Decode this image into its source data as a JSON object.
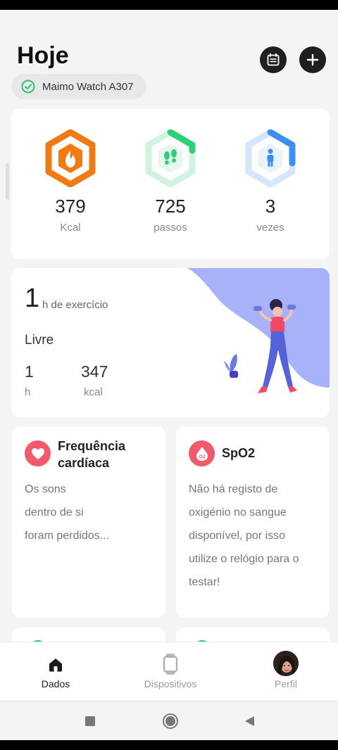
{
  "header": {
    "title": "Hoje",
    "calendar_icon": "calendar-icon",
    "add_icon": "plus-icon",
    "device": {
      "name": "Maimo Watch A307",
      "status_icon": "check-circle-icon",
      "status_color": "#2fbf71"
    }
  },
  "stats": [
    {
      "value": "379",
      "unit": "Kcal",
      "icon": "flame-icon",
      "color": "#f07a14",
      "progress": 1.0
    },
    {
      "value": "725",
      "unit": "passos",
      "icon": "footprints-icon",
      "color": "#2fcf7a",
      "progress": 0.14
    },
    {
      "value": "3",
      "unit": "vezes",
      "icon": "standing-person-icon",
      "color": "#3b8ff0",
      "progress": 0.33
    }
  ],
  "exercise": {
    "value": "1",
    "unit": "h de exercício",
    "mode": "Livre",
    "duration_value": "1",
    "duration_unit": "h",
    "calories_value": "347",
    "calories_unit": "kcal",
    "accent_color": "#a8b2f8"
  },
  "heart_rate": {
    "title": "Frequência cardíaca",
    "icon": "heart-icon",
    "lines": [
      "Os sons",
      "dentro de si",
      "foram perdidos..."
    ]
  },
  "spo2": {
    "title": "SpO2",
    "icon": "o2-drop-icon",
    "icon_text": "O2",
    "lines": [
      "Não há registo de",
      "oxigénio no sangue",
      "disponível, por isso",
      "utilize o relógio para o",
      "testar!"
    ]
  },
  "bottom_nav": [
    {
      "label": "Dados",
      "icon": "home-icon",
      "active": true
    },
    {
      "label": "Dispositivos",
      "icon": "watch-icon",
      "active": false
    },
    {
      "label": "Perfil",
      "icon": "avatar",
      "active": false
    }
  ],
  "system_nav": [
    "square-recents-icon",
    "circle-home-icon",
    "triangle-back-icon"
  ]
}
